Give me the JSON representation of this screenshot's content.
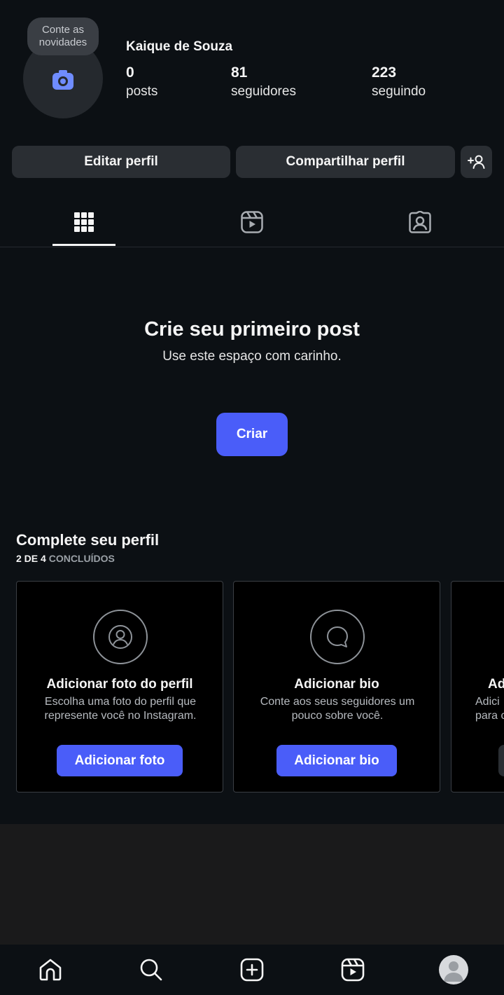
{
  "profile": {
    "name": "Kaique de Souza",
    "note_line1": "Conte as",
    "note_line2": "novidades",
    "stats": [
      {
        "value": "0",
        "label": "posts"
      },
      {
        "value": "81",
        "label": "seguidores"
      },
      {
        "value": "223",
        "label": "seguindo"
      }
    ]
  },
  "actions": {
    "edit": "Editar perfil",
    "share": "Compartilhar perfil",
    "add_person_icon": "add-person-icon"
  },
  "tabs": [
    {
      "icon": "grid-icon",
      "active": true
    },
    {
      "icon": "reels-icon",
      "active": false
    },
    {
      "icon": "tagged-icon",
      "active": false
    }
  ],
  "empty_state": {
    "title": "Crie seu primeiro post",
    "subtitle": "Use este espaço com carinho.",
    "button": "Criar"
  },
  "complete_profile": {
    "title": "Complete seu perfil",
    "progress_done": "2 DE 4",
    "progress_rest": "CONCLUÍDOS",
    "cards": [
      {
        "icon": "person-circle-icon",
        "title": "Adicionar foto do perfil",
        "desc_line1": "Escolha uma foto do perfil que",
        "desc_line2": "represente você no Instagram.",
        "button": "Adicionar foto"
      },
      {
        "icon": "speech-bubble-icon",
        "title": "Adicionar bio",
        "desc_line1": "Conte aos seus seguidores um",
        "desc_line2": "pouco sobre você.",
        "button": "Adicionar bio"
      },
      {
        "title": "Ad",
        "desc_line1": "Adici",
        "desc_line2": "para c"
      }
    ]
  },
  "nav": [
    "home-icon",
    "search-icon",
    "create-icon",
    "reels-icon",
    "profile-avatar"
  ],
  "colors": {
    "background": "#0c1014",
    "accent": "#4a5df9",
    "button_dark": "#2a2e33"
  }
}
